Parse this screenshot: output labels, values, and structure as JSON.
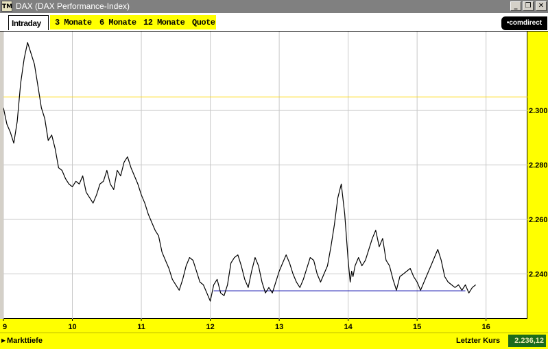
{
  "window": {
    "title": "DAX (DAX Performance-Index)",
    "app_icon_text": "TM",
    "buttons": {
      "minimize": "_",
      "restore": "❐",
      "close": "✕"
    }
  },
  "tabs": [
    {
      "label": "Intraday",
      "active": true
    },
    {
      "label": "3 Monate",
      "active": false
    },
    {
      "label": "6 Monate",
      "active": false
    },
    {
      "label": "12 Monate",
      "active": false
    },
    {
      "label": "Quote",
      "active": false
    }
  ],
  "brand": "•comdirect",
  "colors": {
    "accent": "#ffff00",
    "line": "#000000",
    "reference_line": "#ffd700",
    "support_line": "#0000aa",
    "value_bg": "#1c6b1c"
  },
  "chart_data": {
    "type": "line",
    "title": "",
    "xlabel": "",
    "ylabel": "",
    "x_ticks": [
      "9",
      "10",
      "11",
      "12",
      "13",
      "14",
      "15",
      "16"
    ],
    "y_ticks": [
      "2.240",
      "2.260",
      "2.280",
      "2.300"
    ],
    "xlim": [
      9.0,
      16.6
    ],
    "ylim": [
      2223.5,
      2329.0
    ],
    "reference_level": 2305.0,
    "support_line": {
      "x": [
        12.05,
        15.7
      ],
      "y": 2233.8
    },
    "series": [
      {
        "name": "",
        "x": [
          9.0,
          9.05,
          9.1,
          9.15,
          9.2,
          9.25,
          9.3,
          9.35,
          9.4,
          9.45,
          9.5,
          9.55,
          9.6,
          9.65,
          9.7,
          9.75,
          9.8,
          9.85,
          9.9,
          9.95,
          10.0,
          10.05,
          10.1,
          10.15,
          10.2,
          10.25,
          10.3,
          10.35,
          10.4,
          10.45,
          10.5,
          10.55,
          10.6,
          10.65,
          10.7,
          10.75,
          10.8,
          10.85,
          10.9,
          10.95,
          11.0,
          11.05,
          11.1,
          11.15,
          11.2,
          11.25,
          11.3,
          11.35,
          11.4,
          11.45,
          11.5,
          11.55,
          11.6,
          11.65,
          11.7,
          11.75,
          11.8,
          11.85,
          11.9,
          11.95,
          12.0,
          12.05,
          12.1,
          12.15,
          12.2,
          12.25,
          12.3,
          12.35,
          12.4,
          12.45,
          12.5,
          12.55,
          12.6,
          12.65,
          12.7,
          12.75,
          12.8,
          12.85,
          12.9,
          12.95,
          13.0,
          13.05,
          13.1,
          13.15,
          13.2,
          13.25,
          13.3,
          13.35,
          13.4,
          13.45,
          13.5,
          13.55,
          13.6,
          13.65,
          13.7,
          13.75,
          13.8,
          13.85,
          13.9,
          13.95,
          14.0,
          14.03,
          14.05,
          14.07,
          14.1,
          14.15,
          14.2,
          14.25,
          14.3,
          14.35,
          14.4,
          14.45,
          14.5,
          14.55,
          14.6,
          14.65,
          14.7,
          14.75,
          14.8,
          14.85,
          14.9,
          14.95,
          15.0,
          15.05,
          15.1,
          15.15,
          15.2,
          15.25,
          15.3,
          15.35,
          15.4,
          15.45,
          15.5,
          15.55,
          15.6,
          15.65,
          15.7,
          15.75,
          15.8,
          15.85
        ],
        "y": [
          2301,
          2295,
          2292,
          2288,
          2296,
          2310,
          2319,
          2325,
          2321,
          2317,
          2309,
          2301,
          2297,
          2289,
          2291,
          2286,
          2279,
          2278,
          2275,
          2273,
          2272,
          2274,
          2273,
          2276,
          2270,
          2268,
          2266,
          2269,
          2273,
          2274,
          2278,
          2273,
          2271,
          2278,
          2276,
          2281,
          2283,
          2279,
          2276,
          2273,
          2269,
          2266,
          2262,
          2259,
          2256,
          2254,
          2248,
          2245,
          2242,
          2238,
          2236,
          2234,
          2238,
          2243,
          2246,
          2245,
          2241,
          2237,
          2236,
          2233,
          2230,
          2236,
          2238,
          2233,
          2232,
          2236,
          2244,
          2246,
          2247,
          2243,
          2238,
          2235,
          2241,
          2246,
          2243,
          2237,
          2233,
          2235,
          2233,
          2237,
          2241,
          2244,
          2247,
          2244,
          2240,
          2237,
          2235,
          2238,
          2242,
          2246,
          2245,
          2240,
          2237,
          2240,
          2243,
          2250,
          2258,
          2268,
          2273,
          2262,
          2245,
          2237,
          2241,
          2239,
          2243,
          2246,
          2243,
          2245,
          2249,
          2253,
          2256,
          2250,
          2253,
          2245,
          2243,
          2238,
          2234,
          2239,
          2240,
          2241,
          2242,
          2239,
          2237,
          2234,
          2237,
          2240,
          2243,
          2246,
          2249,
          2245,
          2239,
          2237,
          2236,
          2235,
          2236,
          2234,
          2236,
          2233,
          2235,
          2236
        ]
      }
    ]
  },
  "status": {
    "left_label": "Markttiefe",
    "arrow": "▶",
    "right_label": "Letzter Kurs",
    "value": "2.236,12"
  }
}
